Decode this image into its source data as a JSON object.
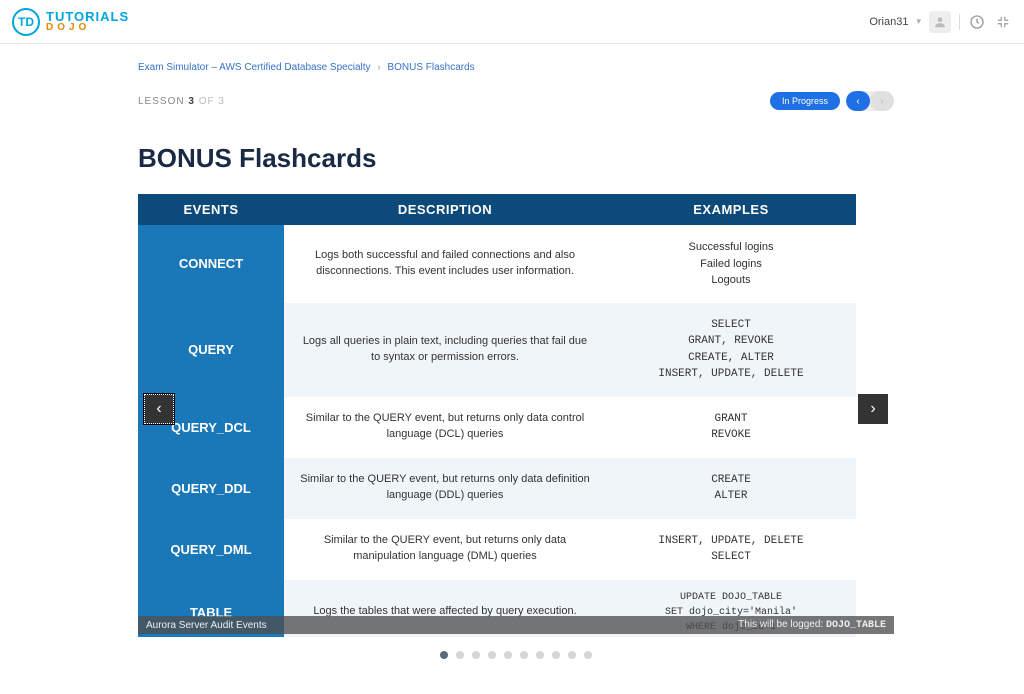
{
  "brand": {
    "badge": "TD",
    "top": "TUTORIALS",
    "bottom": "DOJO"
  },
  "user": {
    "name": "Orian31"
  },
  "breadcrumb": {
    "a": "Exam Simulator – AWS Certified Database Specialty",
    "b": "BONUS Flashcards"
  },
  "lesson": {
    "label": "LESSON",
    "num": "3",
    "of": "OF 3"
  },
  "status_pill": "In Progress",
  "page_title": "BONUS Flashcards",
  "headers": {
    "events": "EVENTS",
    "desc": "DESCRIPTION",
    "ex": "EXAMPLES"
  },
  "rows": [
    {
      "event": "CONNECT",
      "desc": "Logs both successful and failed connections and also disconnections. This event includes user information.",
      "ex_lines": [
        "Successful logins",
        "Failed logins",
        "Logouts"
      ],
      "mono": false
    },
    {
      "event": "QUERY",
      "desc": "Logs all queries in plain text, including queries that fail due to syntax or permission errors.",
      "ex_lines": [
        "SELECT",
        "GRANT, REVOKE",
        "CREATE, ALTER",
        "INSERT, UPDATE, DELETE"
      ],
      "mono": true
    },
    {
      "event": "QUERY_DCL",
      "desc": "Similar to the QUERY event, but returns only data control language (DCL) queries",
      "ex_lines": [
        "GRANT",
        "REVOKE"
      ],
      "mono": true
    },
    {
      "event": "QUERY_DDL",
      "desc": "Similar to the QUERY event, but returns only data definition language (DDL) queries",
      "ex_lines": [
        "CREATE",
        "ALTER"
      ],
      "mono": true
    },
    {
      "event": "QUERY_DML",
      "desc": "Similar to the QUERY event, but returns only data manipulation language (DML) queries",
      "ex_lines": [
        "INSERT, UPDATE, DELETE",
        "SELECT"
      ],
      "mono": true
    },
    {
      "event": "TABLE",
      "desc": "Logs the tables that were affected by query execution.",
      "ex_lines": [
        "UPDATE DOJO_TABLE",
        "SET dojo_city='Manila'",
        "WHERE dojo_id=1"
      ],
      "mono": true
    }
  ],
  "caption": "Aurora Server Audit Events",
  "logged_prefix": "This will be logged: ",
  "logged_value": "DOJO_TABLE",
  "dot_count": 10,
  "active_dot": 0
}
